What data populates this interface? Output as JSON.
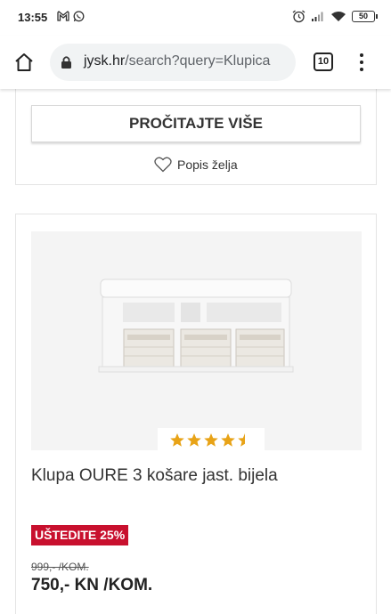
{
  "status_bar": {
    "time": "13:55",
    "battery": "50",
    "icons": [
      "gmail-icon",
      "whatsapp-icon",
      "alarm-icon",
      "signal-icon",
      "wifi-icon",
      "battery-icon"
    ]
  },
  "browser": {
    "url_domain": "jysk.hr",
    "url_path": "/search?query=Klupica",
    "tab_count": "10"
  },
  "top_card": {
    "read_more_label": "PROČITAJTE VIŠE",
    "wishlist_label": "Popis želja"
  },
  "product": {
    "name": "Klupa OURE 3 košare jast. bijela",
    "rating": 4.5,
    "rating_max": 5,
    "save_badge": "UŠTEDITE 25%",
    "old_price": "999,- /KOM.",
    "price": "750,- KN /KOM."
  },
  "colors": {
    "accent_red": "#c8102e",
    "star": "#e8a317"
  }
}
